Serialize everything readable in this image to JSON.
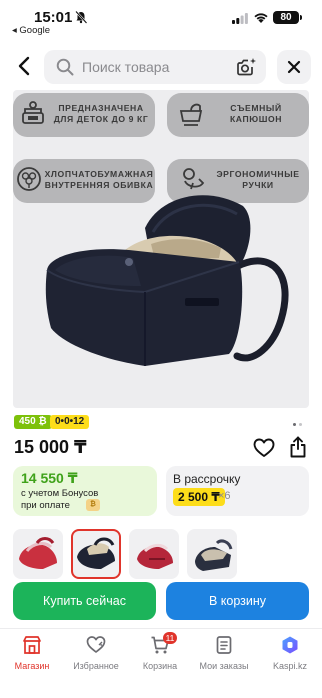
{
  "status_bar": {
    "time": "15:01",
    "back_app": "◂ Google",
    "battery": "80"
  },
  "search": {
    "placeholder": "Поиск товара"
  },
  "product": {
    "features": [
      {
        "text": "Предназначена для деток до 9 кг",
        "icon": "scale-icon"
      },
      {
        "text": "Съемный капюшон",
        "icon": "carrycot-hood-icon"
      },
      {
        "text": "Хлопчатобумажная внутренняя обивка",
        "icon": "cotton-icon"
      },
      {
        "text": "Эргономичные ручки",
        "icon": "baby-icon"
      }
    ],
    "bonus_chip": "450 ₿",
    "bonus_chip2": "0•0•12",
    "price": "15 000 ₸",
    "bonus_price": "14 550 ₸",
    "bonus_note_line1": "с учетом Бонусов",
    "bonus_note_line2": "при оплате",
    "installment_title": "В рассрочку",
    "installment_amount": "2 500 ₸",
    "installment_multiplier": "×6"
  },
  "colors": {
    "green": "#1cb45a",
    "blue": "#1d82e0",
    "red": "#e0342b",
    "bonus_green": "#7dc10a",
    "yellow": "#fddd1a"
  },
  "actions": {
    "buy_now": "Купить сейчас",
    "add_to_cart": "В корзину"
  },
  "tabbar": {
    "items": [
      {
        "label": "Магазин",
        "icon": "shop-icon",
        "active": true
      },
      {
        "label": "Избранное",
        "icon": "heart-icon"
      },
      {
        "label": "Корзина",
        "icon": "cart-icon",
        "badge": "11"
      },
      {
        "label": "Мои заказы",
        "icon": "orders-icon"
      },
      {
        "label": "Kaspi.kz",
        "icon": "kaspi-icon"
      }
    ]
  }
}
